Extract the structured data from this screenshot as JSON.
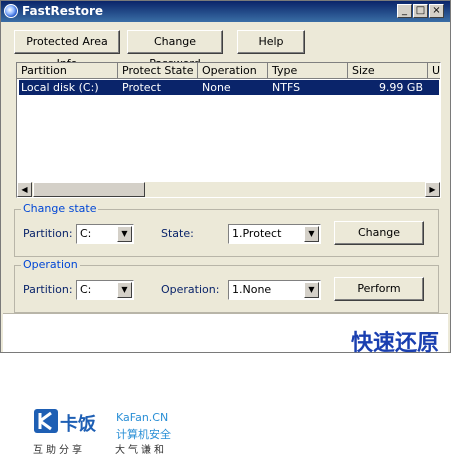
{
  "window": {
    "title": "FastRestore",
    "controls": [
      "_",
      "□",
      "×"
    ]
  },
  "toolbar": {
    "protected_area_info": "Protected Area Info",
    "change_password": "Change Password",
    "help": "Help"
  },
  "partition_list": {
    "columns": [
      "Partition",
      "Protect State",
      "Operation",
      "Type",
      "Size",
      "Us"
    ],
    "rows": [
      {
        "partition": "Local disk (C:)",
        "protect_state": "Protect",
        "operation": "None",
        "type": "NTFS",
        "size": "9.99 GB"
      }
    ]
  },
  "change_state": {
    "group_label": "Change state",
    "partition_label": "Partition:",
    "partition_value": "C:",
    "state_label": "State:",
    "state_value": "1.Protect",
    "button": "Change"
  },
  "operation": {
    "group_label": "Operation",
    "partition_label": "Partition:",
    "partition_value": "C:",
    "operation_label": "Operation:",
    "operation_value": "1.None",
    "button": "Perform"
  },
  "brand": {
    "chinese_title": "快速还原"
  },
  "watermark": {
    "name_cn": "卡饭",
    "name_en": "KaFan.CN",
    "subtitle": "计算机安全",
    "slogan_left": "互助分享",
    "slogan_right": "大气谦和"
  },
  "colors": {
    "title_bar": "#0a246a",
    "selection": "#0a246a",
    "group_label": "#0046d5",
    "brand_blue": "#1a3fb0"
  }
}
